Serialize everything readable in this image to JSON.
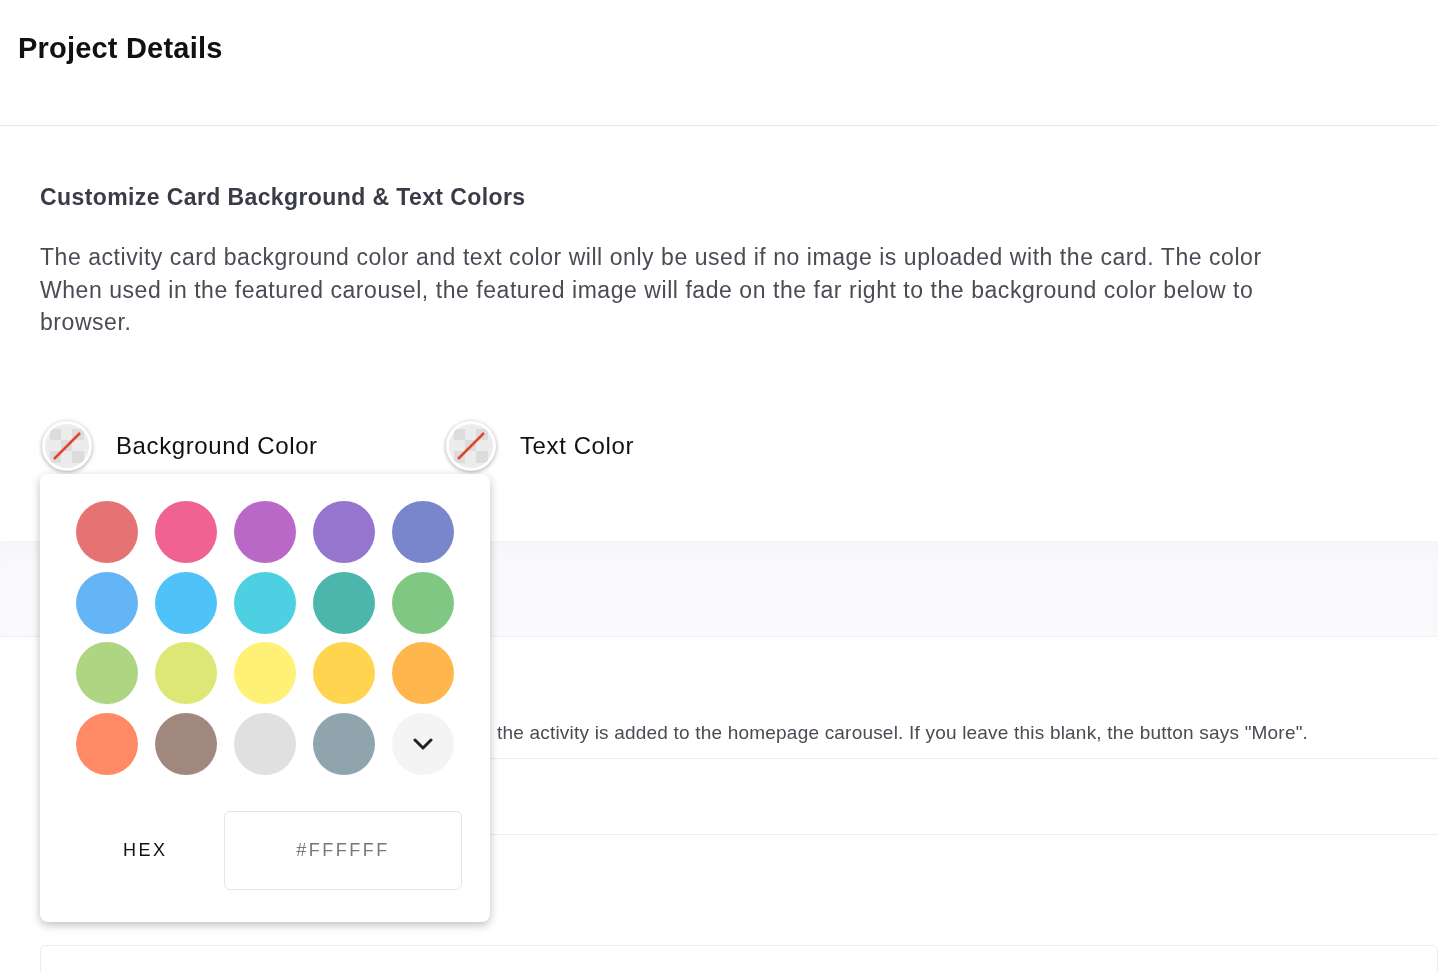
{
  "header": {
    "title": "Project Details"
  },
  "section": {
    "title": "Customize Card Background & Text Colors",
    "description_lines": [
      "The activity card background color and text color will only be used if no image is uploaded with the card. The color",
      "When used in the featured carousel, the featured image will fade on the far right to the background color below to",
      "browser."
    ]
  },
  "color_pickers": [
    {
      "label": "Background Color"
    },
    {
      "label": "Text Color"
    }
  ],
  "popover": {
    "swatches": [
      {
        "color": "#e57373"
      },
      {
        "color": "#f06292"
      },
      {
        "color": "#ba68c8"
      },
      {
        "color": "#9575cd"
      },
      {
        "color": "#7986cb"
      },
      {
        "color": "#64b5f6"
      },
      {
        "color": "#4fc3f7"
      },
      {
        "color": "#4dd0e1"
      },
      {
        "color": "#4db6ac"
      },
      {
        "color": "#81c784"
      },
      {
        "color": "#aed581"
      },
      {
        "color": "#dce775"
      },
      {
        "color": "#fff176"
      },
      {
        "color": "#ffd54f"
      },
      {
        "color": "#ffb74d"
      },
      {
        "color": "#ff8a65"
      },
      {
        "color": "#a1887f"
      },
      {
        "color": "#e0e0e0"
      },
      {
        "color": "#90a4ae"
      }
    ],
    "hex_label": "HEX",
    "hex_placeholder": "#FFFFFF"
  },
  "help_text": "the activity is added to the homepage carousel. If you leave this blank, the button says \"More\"."
}
